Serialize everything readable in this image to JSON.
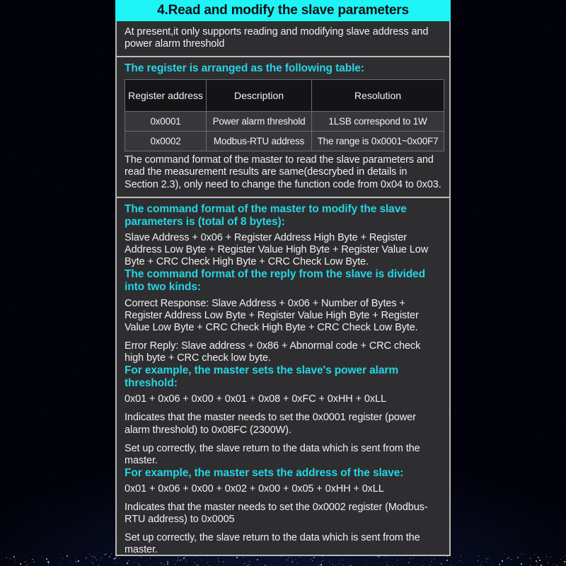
{
  "header": {
    "title": "4.Read and modify the slave parameters"
  },
  "intro": {
    "text": "At present,it only supports reading and modifying slave address and power alarm threshold"
  },
  "register_section": {
    "heading": "The register is arranged as the following table:",
    "table": {
      "columns": [
        "Register address",
        "Description",
        "Resolution"
      ],
      "rows": [
        [
          "0x0001",
          "Power alarm threshold",
          "1LSB correspond to 1W"
        ],
        [
          "0x0002",
          "Modbus-RTU address",
          "The range is 0x0001~0x00F7"
        ]
      ]
    },
    "note": "The command format of the master to read the slave parameters and read the measurement results are same(descrybed in details in Section 2.3), only need to change the function code from 0x04 to 0x03."
  },
  "command_section": {
    "modify_heading": "The command format of the master to modify the slave parameters is (total of 8 bytes):",
    "modify_body": "Slave Address + 0x06 + Register Address High Byte + Register Address Low Byte + Register Value High Byte + Register Value Low Byte + CRC Check High Byte + CRC Check Low Byte.",
    "reply_heading": "The command format of the reply from the slave is divided into two kinds:",
    "correct_response": "Correct Response: Slave Address + 0x06 + Number of Bytes + Register Address Low Byte + Register Value High Byte + Register Value Low Byte + CRC Check High Byte + CRC Check Low Byte.",
    "error_reply": "Error Reply: Slave address + 0x86 + Abnormal code + CRC check high byte + CRC check low byte.",
    "example1_heading": "For example, the master sets the slave's power alarm threshold:",
    "example1_command": "0x01 + 0x06 + 0x00 + 0x01 + 0x08 + 0xFC + 0xHH + 0xLL",
    "example1_note": "Indicates that the master needs to set the 0x0001 register (power alarm threshold) to 0x08FC (2300W).",
    "example1_result": "Set up correctly, the slave return to the data which is sent from the master.",
    "example2_heading": "For example, the master sets the address of the slave:",
    "example2_command": "0x01 + 0x06 + 0x00 + 0x02 + 0x00 + 0x05 + 0xHH + 0xLL",
    "example2_note": "Indicates that the master needs to set the 0x0002 register (Modbus-RTU address) to 0x0005",
    "example2_result": "Set up correctly, the slave return to the data which is sent from the master."
  },
  "colors": {
    "title_bar": "#1ef3f5",
    "heading_cyan": "#24d5e2",
    "panel_bg": "#2e2e31",
    "page_bg": "#02020a",
    "border": "#bdbdbd",
    "table_header_bg": "#141416",
    "table_cell_bg": "#37373a"
  }
}
